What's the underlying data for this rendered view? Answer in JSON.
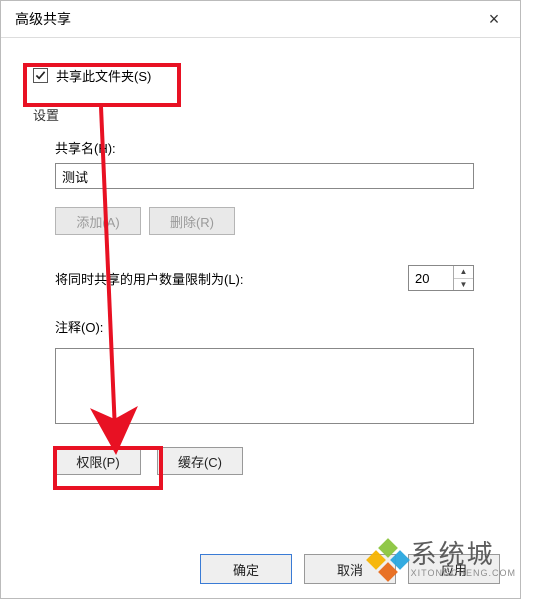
{
  "dialog": {
    "title": "高级共享",
    "close_icon": "×"
  },
  "share_checkbox": {
    "checked": true,
    "label": "共享此文件夹(S)"
  },
  "settings": {
    "group_label": "设置",
    "share_name_label": "共享名(H):",
    "share_name_value": "测试",
    "add_button": "添加(A)",
    "remove_button": "删除(R)",
    "limit_label": "将同时共享的用户数量限制为(L):",
    "limit_value": "20",
    "comment_label": "注释(O):",
    "comment_value": "",
    "permissions_button": "权限(P)",
    "cache_button": "缓存(C)"
  },
  "footer": {
    "ok": "确定",
    "cancel": "取消",
    "apply": "应用"
  },
  "watermark": {
    "text": "系统城",
    "url": "XITONGCHENG.COM"
  }
}
